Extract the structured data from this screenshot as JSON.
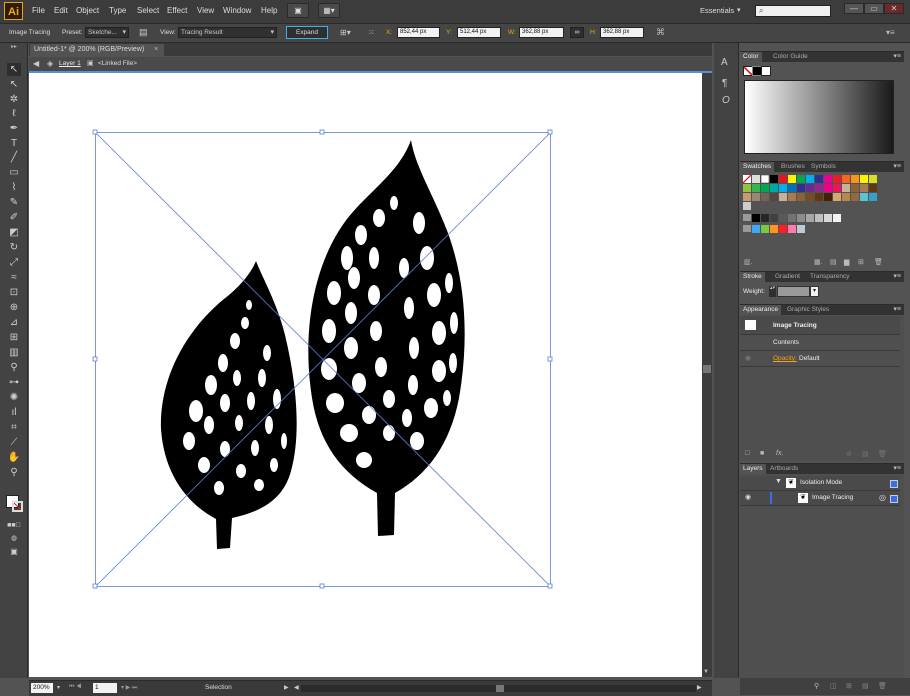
{
  "menubar": {
    "logo": "Ai",
    "menus": [
      "File",
      "Edit",
      "Object",
      "Type",
      "Select",
      "Effect",
      "View",
      "Window",
      "Help"
    ],
    "workspace": "Essentials",
    "search_placeholder": "",
    "window_buttons": [
      "—",
      "▭",
      "✕"
    ]
  },
  "control": {
    "object_type": "Image Tracing",
    "preset_label": "Preset:",
    "preset_value": "Sketche...",
    "view_label": "View:",
    "view_value": "Tracing Result",
    "expand_label": "Expand",
    "x_label": "X:",
    "x_value": "852,44 px",
    "y_label": "Y:",
    "y_value": "512,44 px",
    "w_label": "W:",
    "w_value": "362,88 px",
    "h_label": "H:",
    "h_value": "362,88 px"
  },
  "document": {
    "tab_title": "Untitled-1* @ 200% (RGB/Preview)",
    "tab_close": "×",
    "layer_label": "Layer 1",
    "linked_label": "<Linked File>"
  },
  "status": {
    "zoom": "200%",
    "artboard": "1",
    "tool_label": "Selection"
  },
  "panels": {
    "color_tabs": [
      "Color",
      "Color Guide"
    ],
    "swatch_tabs": [
      "Swatches",
      "Brushes",
      "Symbols"
    ],
    "stroke_tabs": [
      "Stroke",
      "Gradient",
      "Transparency"
    ],
    "weight_label": "Weight:",
    "appearance_tabs": [
      "Appearance",
      "Graphic Styles"
    ],
    "appearance_title": "Image Tracing",
    "appearance_contents": "Contents",
    "opacity_label": "Opacity:",
    "opacity_value": "Default",
    "layers_tabs": [
      "Layers",
      "Artboards"
    ],
    "layer_rows": [
      "Isolation Mode",
      "Image Tracing"
    ]
  },
  "colors": {
    "accent": "#f7a21b",
    "selection": "#5a7fd6"
  }
}
